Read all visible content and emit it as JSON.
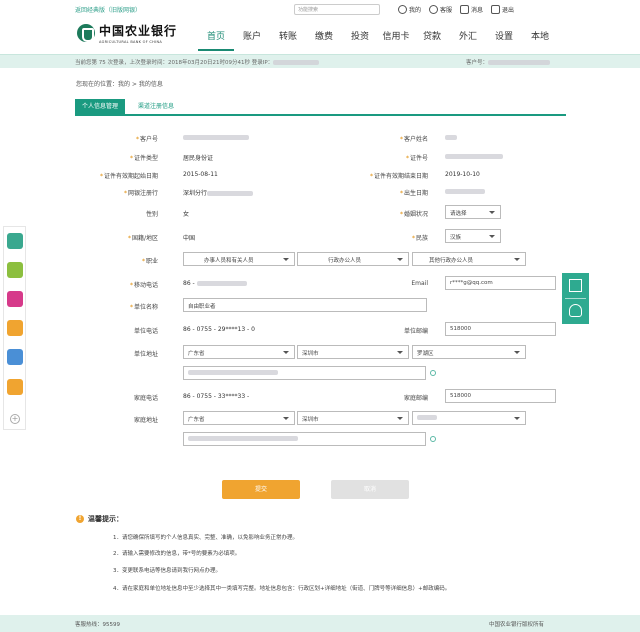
{
  "topbar": {
    "back_link": "返回经典版（旧版网银）",
    "search_placeholder": "功能搜索",
    "links": [
      {
        "label": "我的",
        "icon": "user-icon"
      },
      {
        "label": "客服",
        "icon": "headset-icon"
      },
      {
        "label": "消息",
        "icon": "mail-icon"
      },
      {
        "label": "退出",
        "icon": "logout-icon"
      }
    ]
  },
  "header": {
    "bank_name_cn": "中国农业银行",
    "bank_name_en": "AGRICULTURAL BANK OF CHINA",
    "nav": [
      {
        "label": "首页",
        "active": true
      },
      {
        "label": "账户",
        "active": false
      },
      {
        "label": "转账",
        "active": false
      },
      {
        "label": "缴费",
        "active": false
      },
      {
        "label": "投资",
        "active": false
      },
      {
        "label": "信用卡",
        "active": false
      },
      {
        "label": "贷款",
        "active": false
      },
      {
        "label": "外汇",
        "active": false
      },
      {
        "label": "设置",
        "active": false
      },
      {
        "label": "本地",
        "active": false
      }
    ]
  },
  "infobar": {
    "left_text": "当前您第 75 次登录，上次登录时间：2018年03月20日21时09分41秒  登录IP：",
    "right_text": "客户号："
  },
  "breadcrumb": "您现在的位置：我的 > 我的信息",
  "tabs": [
    {
      "label": "个人信息管理",
      "active": true
    },
    {
      "label": "渠道注册信息",
      "active": false
    }
  ],
  "form": {
    "customer_no_label": "客户号",
    "customer_name_label": "客户姓名",
    "id_type_label": "证件类型",
    "id_type_value": "居民身份证",
    "id_no_label": "证件号",
    "id_start_label": "证件有效期起始日期",
    "id_start_value": "2015-08-11",
    "id_end_label": "证件有效期结束日期",
    "id_end_value": "2019-10-10",
    "reg_date_label": "网银注册行",
    "reg_date_value": "深圳分行",
    "birth_label": "出生日期",
    "gender_label": "性别",
    "gender_value": "女",
    "marital_label": "婚姻状况",
    "marital_value": "请选择",
    "nation_label": "国籍/地区",
    "nation_value": "中国",
    "ethnic_label": "民族",
    "ethnic_value": "汉族",
    "job_label": "职业",
    "job_values": [
      "办事人员和有关人员",
      "行政办公人员",
      "其他行政办公人员"
    ],
    "mobile_label": "移动电话",
    "mobile_value": "86 -",
    "email_label": "Email",
    "email_value": "r****g@qq.com",
    "company_label": "单位名称",
    "company_value": "自由职业者",
    "work_phone_label": "单位电话",
    "work_phone_value": "86 - 0755 - 29****13 - 0",
    "work_zip_label": "单位邮编",
    "work_zip_value": "518000",
    "work_addr_label": "单位地址",
    "work_addr_values": [
      "广东省",
      "深圳市",
      "罗湖区"
    ],
    "home_phone_label": "家庭电话",
    "home_phone_value": "86 - 0755 - 33****33 -",
    "home_zip_label": "家庭邮编",
    "home_zip_value": "518000",
    "home_addr_label": "家庭地址",
    "home_addr_values": [
      "广东省",
      "深圳市",
      ""
    ]
  },
  "buttons": {
    "submit": "提交",
    "cancel": "取消"
  },
  "tips": {
    "title": "温馨提示：",
    "items": [
      "1．请您确保所填写的个人信息真实、完整、准确，以免影响业务正常办理。",
      "2．请输入需要修改的信息，带*号的要素为必填项。",
      "3．变更联系电话等信息请到我行网点办理。",
      "4．请在家庭和单位地址信息中至少选择其中一类填写完整。地址信息包含：行政区划+详细地址（街道、门牌号等详细信息）+邮政编码。"
    ]
  },
  "footer": {
    "hotline": "客服热线：95599",
    "copyright": "中国农业银行版权所有"
  },
  "sidebar_icons": [
    "card-icon",
    "yuan-icon",
    "chart-icon",
    "coins-icon",
    "calculator-icon",
    "dollar-icon",
    "plus-icon"
  ],
  "right_float_icons": [
    "qr-code-icon",
    "service-icon"
  ]
}
